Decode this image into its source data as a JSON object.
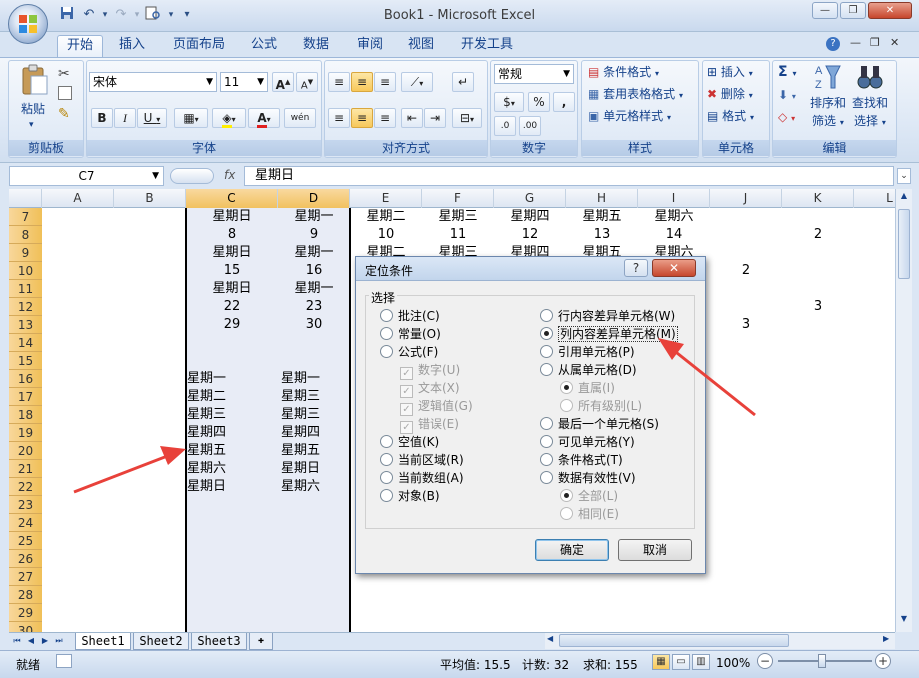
{
  "window": {
    "title": "Book1 - Microsoft Excel",
    "minimize": "—",
    "restore": "❐",
    "close": "✕"
  },
  "qat": {
    "save": "💾",
    "undo": "↶",
    "redo": "↷",
    "print_preview": "🖨",
    "more": "▾"
  },
  "tabs": [
    "开始",
    "插入",
    "页面布局",
    "公式",
    "数据",
    "审阅",
    "视图",
    "开发工具"
  ],
  "ribbon": {
    "clipboard": {
      "label": "剪贴板",
      "paste": "粘贴"
    },
    "font": {
      "label": "字体",
      "family": "宋体",
      "size": "11",
      "bold": "B",
      "italic": "I",
      "underline": "U",
      "grow": "A",
      "shrink": "A",
      "color": "A",
      "phonetic": "wén"
    },
    "alignment": {
      "label": "对齐方式"
    },
    "number": {
      "label": "数字",
      "format": "常规",
      "percent": "%",
      "comma": ","
    },
    "styles": {
      "label": "样式",
      "conditional": "条件格式",
      "table": "套用表格格式",
      "cell_styles": "单元格样式"
    },
    "cells": {
      "label": "单元格",
      "insert": "插入",
      "delete": "删除",
      "format": "格式"
    },
    "editing": {
      "label": "编辑",
      "sigma": "Σ",
      "sort": "排序和",
      "sort2": "筛选",
      "find": "查找和",
      "find2": "选择"
    }
  },
  "formula_bar": {
    "name_box": "C7",
    "fx": "fx",
    "content": "星期日"
  },
  "columns": [
    "A",
    "B",
    "C",
    "D",
    "E",
    "F",
    "G",
    "H",
    "I",
    "J",
    "K",
    "L"
  ],
  "rows": [
    "7",
    "8",
    "9",
    "10",
    "11",
    "12",
    "13",
    "14",
    "15",
    "16",
    "17",
    "18",
    "19",
    "20",
    "21",
    "22",
    "23",
    "24",
    "25",
    "26",
    "27",
    "28",
    "29",
    "30"
  ],
  "cells": {
    "c7": "星期日",
    "d7": "星期一",
    "e7": "星期二",
    "f7": "星期三",
    "g7": "星期四",
    "h7": "星期五",
    "i7": "星期六",
    "c8": "8",
    "d8": "9",
    "e8": "10",
    "f8": "11",
    "g8": "12",
    "h8": "13",
    "i8": "14",
    "k8": "2",
    "c9": "星期日",
    "d9": "星期一",
    "e9": "星期二",
    "f9": "星期三",
    "g9": "星期四",
    "h9": "星期五",
    "i9": "星期六",
    "c10": "15",
    "d10": "16",
    "j10": "2",
    "c11": "星期日",
    "d11": "星期一",
    "c12": "22",
    "d12": "23",
    "k12": "3",
    "c13": "29",
    "d13": "30",
    "j13": "3",
    "c16": "星期一",
    "d16": "星期一",
    "c17": "星期二",
    "d17": "星期三",
    "c18": "星期三",
    "d18": "星期三",
    "c19": "星期四",
    "d19": "星期四",
    "c20": "星期五",
    "d20": "星期五",
    "c21": "星期六",
    "d21": "星期日",
    "c22": "星期日",
    "d22": "星期六"
  },
  "dialog": {
    "title": "定位条件",
    "help": "?",
    "close": "✕",
    "group_label": "选择",
    "left_options": [
      {
        "label": "批注(C)",
        "type": "radio",
        "on": false,
        "dim": false
      },
      {
        "label": "常量(O)",
        "type": "radio",
        "on": false,
        "dim": false
      },
      {
        "label": "公式(F)",
        "type": "radio",
        "on": false,
        "dim": false
      },
      {
        "label": "数字(U)",
        "type": "check",
        "on": true,
        "dim": true
      },
      {
        "label": "文本(X)",
        "type": "check",
        "on": true,
        "dim": true
      },
      {
        "label": "逻辑值(G)",
        "type": "check",
        "on": true,
        "dim": true
      },
      {
        "label": "错误(E)",
        "type": "check",
        "on": true,
        "dim": true
      },
      {
        "label": "空值(K)",
        "type": "radio",
        "on": false,
        "dim": false
      },
      {
        "label": "当前区域(R)",
        "type": "radio",
        "on": false,
        "dim": false
      },
      {
        "label": "当前数组(A)",
        "type": "radio",
        "on": false,
        "dim": false
      },
      {
        "label": "对象(B)",
        "type": "radio",
        "on": false,
        "dim": false
      }
    ],
    "right_options": [
      {
        "label": "行内容差异单元格(W)",
        "type": "radio",
        "on": false,
        "dim": false
      },
      {
        "label": "列内容差异单元格(M)",
        "type": "radio",
        "on": true,
        "dim": false
      },
      {
        "label": "引用单元格(P)",
        "type": "radio",
        "on": false,
        "dim": false
      },
      {
        "label": "从属单元格(D)",
        "type": "radio",
        "on": false,
        "dim": false
      },
      {
        "label": "直属(I)",
        "type": "radio",
        "on": true,
        "dim": true
      },
      {
        "label": "所有级别(L)",
        "type": "radio",
        "on": false,
        "dim": true
      },
      {
        "label": "最后一个单元格(S)",
        "type": "radio",
        "on": false,
        "dim": false
      },
      {
        "label": "可见单元格(Y)",
        "type": "radio",
        "on": false,
        "dim": false
      },
      {
        "label": "条件格式(T)",
        "type": "radio",
        "on": false,
        "dim": false
      },
      {
        "label": "数据有效性(V)",
        "type": "radio",
        "on": false,
        "dim": false
      },
      {
        "label": "全部(L)",
        "type": "radio",
        "on": true,
        "dim": true
      },
      {
        "label": "相同(E)",
        "type": "radio",
        "on": false,
        "dim": true
      }
    ],
    "ok": "确定",
    "cancel": "取消"
  },
  "sheets": [
    "Sheet1",
    "Sheet2",
    "Sheet3"
  ],
  "status": {
    "ready": "就绪",
    "average": "平均值: 15.5",
    "count": "计数: 32",
    "sum": "求和: 155",
    "zoom": "100%"
  },
  "colors": {
    "arrow": "#e8413a",
    "selection": "#e8ecf6",
    "row_header": "#f0c058"
  }
}
